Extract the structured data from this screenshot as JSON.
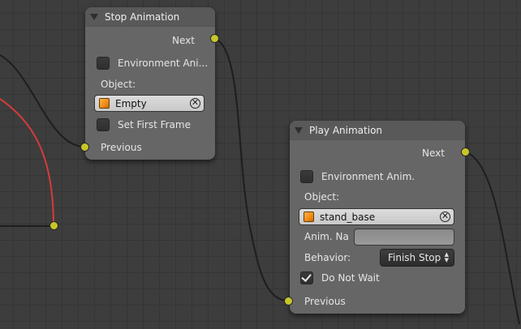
{
  "nodes": {
    "stop_animation": {
      "title": "Stop Animation",
      "next_label": "Next",
      "environment_label": "Environment Ani...",
      "environment_checked": false,
      "object_label": "Object:",
      "object_value": "Empty",
      "set_first_frame_label": "Set First Frame",
      "set_first_frame_checked": false,
      "previous_label": "Previous"
    },
    "play_animation": {
      "title": "Play Animation",
      "next_label": "Next",
      "environment_label": "Environment Anim.",
      "environment_checked": false,
      "object_label": "Object:",
      "object_value": "stand_base",
      "anim_name_label": "Anim. Na",
      "anim_name_value": "",
      "behavior_label": "Behavior:",
      "behavior_value": "Finish Stop",
      "do_not_wait_label": "Do Not Wait",
      "do_not_wait_checked": true,
      "previous_label": "Previous"
    }
  },
  "colors": {
    "socket": "#c7c729",
    "link": "#1e1e1e",
    "link_active": "#d63b3b",
    "node_body": "#666666",
    "background": "#3d3d3d"
  },
  "icons": {
    "collapse": "triangle-down-icon",
    "object": "cube-icon",
    "clear": "x-icon",
    "dropdown": "updown-arrows-icon",
    "check": "checkmark-icon"
  }
}
